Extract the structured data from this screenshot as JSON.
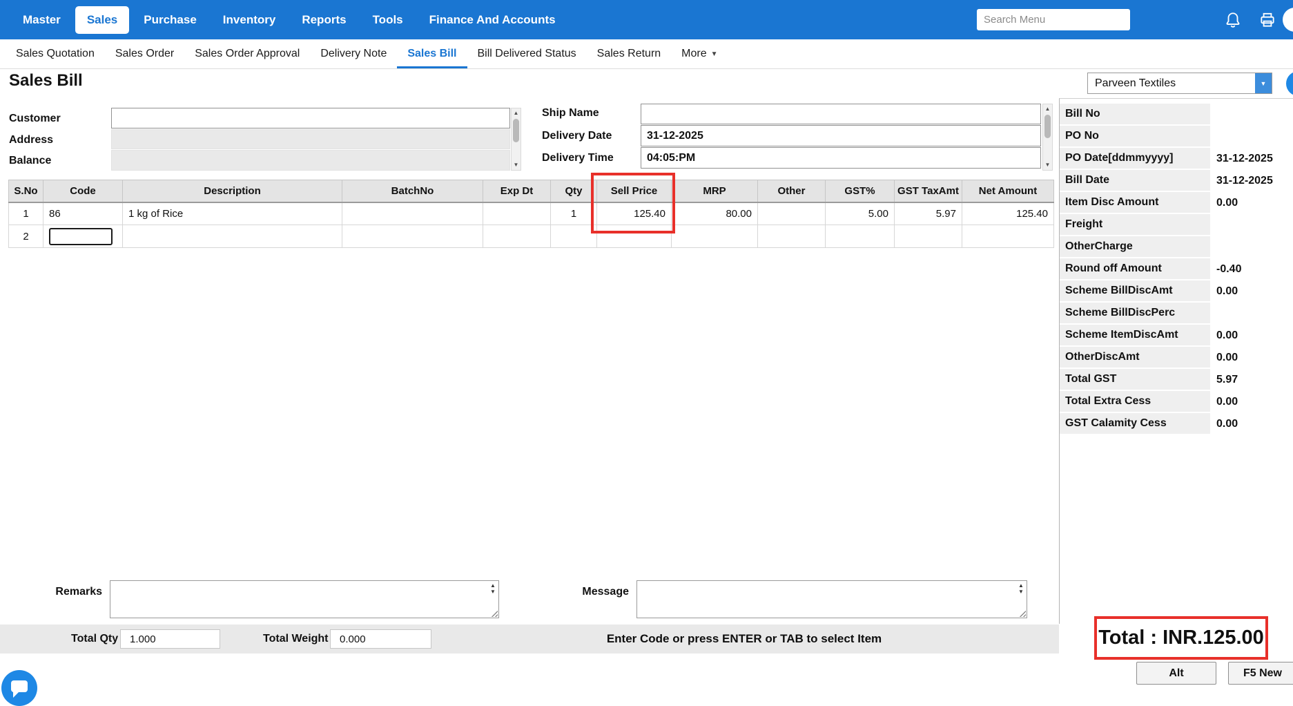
{
  "topnav": {
    "items": [
      "Master",
      "Sales",
      "Purchase",
      "Inventory",
      "Reports",
      "Tools",
      "Finance And Accounts"
    ],
    "active": "Sales",
    "search_placeholder": "Search Menu"
  },
  "subnav": {
    "items": [
      "Sales Quotation",
      "Sales Order",
      "Sales Order Approval",
      "Delivery Note",
      "Sales Bill",
      "Bill Delivered Status",
      "Sales Return",
      "More"
    ],
    "active": "Sales Bill"
  },
  "page": {
    "title": "Sales Bill",
    "company": "Parveen Textiles"
  },
  "form": {
    "customer_label": "Customer",
    "address_label": "Address",
    "balance_label": "Balance",
    "ship_name_label": "Ship Name",
    "delivery_date_label": "Delivery Date",
    "delivery_date": "31-12-2025",
    "delivery_time_label": "Delivery Time",
    "delivery_time": "04:05:PM"
  },
  "items_table": {
    "columns": [
      "S.No",
      "Code",
      "Description",
      "BatchNo",
      "Exp Dt",
      "Qty",
      "Sell Price",
      "MRP",
      "Other",
      "GST%",
      "GST TaxAmt",
      "Net Amount"
    ],
    "rows": [
      [
        "1",
        "86",
        "1 kg of Rice",
        "",
        "",
        "1",
        "125.40",
        "80.00",
        "",
        "5.00",
        "5.97",
        "125.40"
      ],
      [
        "2",
        "",
        "",
        "",
        "",
        "",
        "",
        "",
        "",
        "",
        "",
        ""
      ]
    ]
  },
  "summary": {
    "rows": [
      {
        "label": "Bill No",
        "value": ""
      },
      {
        "label": "PO No",
        "value": ""
      },
      {
        "label": "PO Date[ddmmyyyy]",
        "value": "31-12-2025"
      },
      {
        "label": "Bill Date",
        "value": "31-12-2025"
      },
      {
        "label": "Item Disc Amount",
        "value": "0.00"
      },
      {
        "label": "Freight",
        "value": ""
      },
      {
        "label": "OtherCharge",
        "value": ""
      },
      {
        "label": "Round off Amount",
        "value": "-0.40"
      },
      {
        "label": "Scheme BillDiscAmt",
        "value": "0.00"
      },
      {
        "label": "Scheme BillDiscPerc",
        "value": ""
      },
      {
        "label": "Scheme ItemDiscAmt",
        "value": "0.00"
      },
      {
        "label": "OtherDiscAmt",
        "value": "0.00"
      },
      {
        "label": "Total GST",
        "value": "5.97"
      },
      {
        "label": "Total Extra Cess",
        "value": "0.00"
      },
      {
        "label": "GST Calamity Cess",
        "value": "0.00"
      }
    ]
  },
  "footer": {
    "remarks_label": "Remarks",
    "message_label": "Message",
    "total_qty_label": "Total Qty",
    "total_qty": "1.000",
    "total_weight_label": "Total Weight",
    "total_weight": "0.000",
    "hint": "Enter Code or press ENTER or TAB to select Item",
    "total_text": "Total : INR.125.00",
    "alt_button": "Alt",
    "f5_new_button": "F5 New"
  },
  "colors": {
    "accent_blue": "#1a76d2",
    "annotation_red": "#e8302a",
    "header_gray": "#e4e4e4"
  }
}
